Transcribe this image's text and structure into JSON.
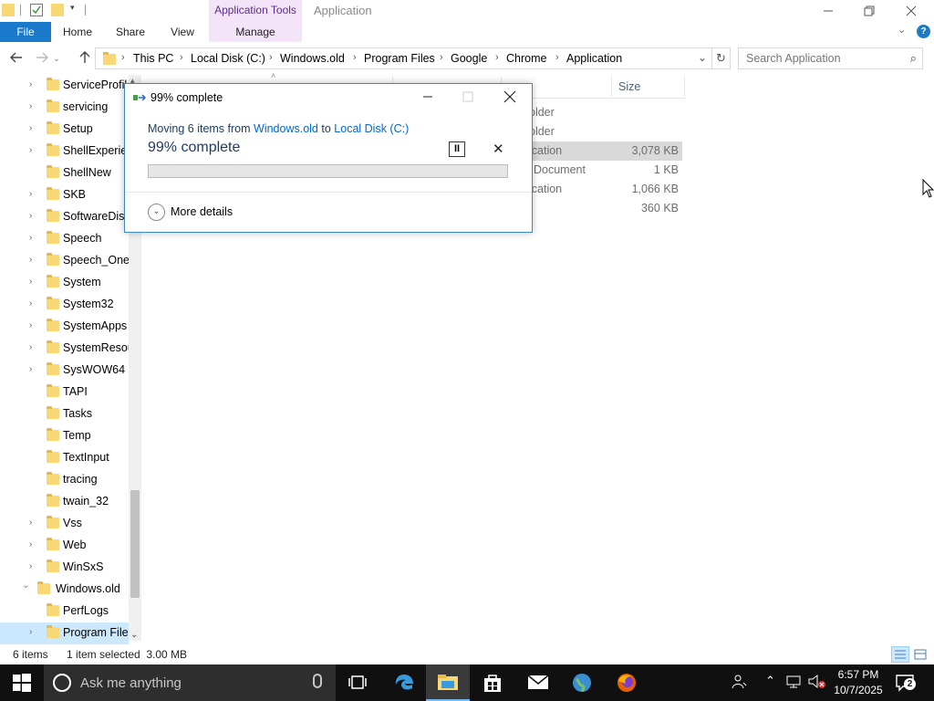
{
  "window": {
    "title": "Application",
    "context_tab": "Application Tools",
    "min_icon": "minimize-icon",
    "max_icon": "restore-icon",
    "close_icon": "close-icon"
  },
  "ribbon": {
    "tabs": [
      {
        "label": "File"
      },
      {
        "label": "Home"
      },
      {
        "label": "Share"
      },
      {
        "label": "View"
      },
      {
        "label": "Manage"
      }
    ]
  },
  "address": {
    "crumbs": [
      "This PC",
      "Local Disk (C:)",
      "Windows.old",
      "Program Files",
      "Google",
      "Chrome",
      "Application"
    ]
  },
  "search": {
    "placeholder": "Search Application"
  },
  "nav": {
    "items": [
      {
        "label": "ServiceProfil"
      },
      {
        "label": "servicing"
      },
      {
        "label": "Setup"
      },
      {
        "label": "ShellExperien"
      },
      {
        "label": "ShellNew"
      },
      {
        "label": "SKB"
      },
      {
        "label": "SoftwareDistr"
      },
      {
        "label": "Speech"
      },
      {
        "label": "Speech_OneC"
      },
      {
        "label": "System"
      },
      {
        "label": "System32"
      },
      {
        "label": "SystemApps"
      },
      {
        "label": "SystemResou"
      },
      {
        "label": "SysWOW64"
      },
      {
        "label": "TAPI"
      },
      {
        "label": "Tasks"
      },
      {
        "label": "Temp"
      },
      {
        "label": "TextInput"
      },
      {
        "label": "tracing"
      },
      {
        "label": "twain_32"
      },
      {
        "label": "Vss"
      },
      {
        "label": "Web"
      },
      {
        "label": "WinSxS"
      },
      {
        "label": "Windows.old"
      },
      {
        "label": "PerfLogs"
      },
      {
        "label": "Program Files"
      }
    ]
  },
  "columns": {
    "size": "Size"
  },
  "files": [
    {
      "type": "older",
      "size": ""
    },
    {
      "type": "older",
      "size": ""
    },
    {
      "type": "ication",
      "size": "3,078 KB"
    },
    {
      "type": "Document",
      "size": "1 KB"
    },
    {
      "type": "ication",
      "size": "1,066 KB"
    },
    {
      "type": "",
      "size": "360 KB"
    }
  ],
  "dialog": {
    "title": "99% complete",
    "moving_prefix": "Moving 6 items from",
    "source": "Windows.old",
    "to": "to",
    "destination": "Local Disk (C:)",
    "percent_text": "99% complete",
    "progress": 0.99,
    "pause_label": "II",
    "cancel_label": "✕",
    "more_details": "More details"
  },
  "status": {
    "items_count": "6 items",
    "selection": "1 item selected  3.00 MB"
  },
  "taskbar": {
    "search_placeholder": "Ask me anything",
    "time": "6:57 PM",
    "date": "10/7/2025",
    "notification_count": "2"
  },
  "colors": {
    "accent": "#1979ca",
    "context_tab": "#f3e4f7",
    "selection": "#cce8ff",
    "taskbar": "#101010"
  }
}
